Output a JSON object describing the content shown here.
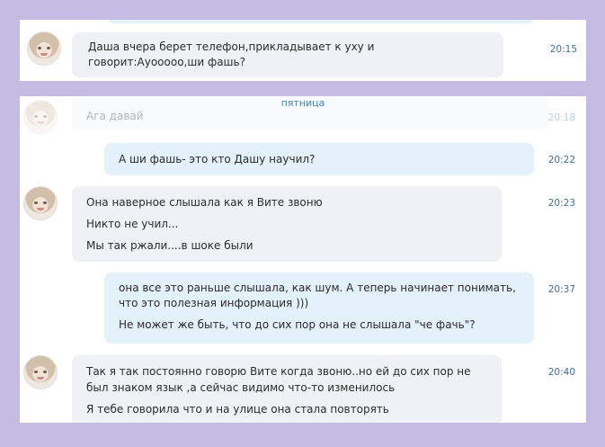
{
  "top": {
    "message": {
      "lines": [
        "Даша вчера берет телефон,прикладывает к уху и",
        "говорит:Ауооооо,ши фашь?"
      ],
      "time": "20:15"
    }
  },
  "main": {
    "day_divider": "пятница",
    "faded_message": {
      "text": "Ага давай",
      "time": "20:18"
    },
    "messages": [
      {
        "direction": "out",
        "lines": [
          "А ши фашь- это кто Дашу научил?"
        ],
        "time": "20:22"
      },
      {
        "direction": "in",
        "lines": [
          "Она наверное слышала как я Вите звоню",
          "Никто не учил...",
          "Мы так ржали....в шоке были"
        ],
        "time": "20:23"
      },
      {
        "direction": "out",
        "lines": [
          "она все это раньше слышала, как шум. А теперь начинает понимать,",
          "что это полезная информация )))",
          "Не может же быть, что до сих пор она не слышала \"че фачь\"?"
        ],
        "time": "20:37"
      },
      {
        "direction": "in",
        "lines": [
          "Так я так постоянно говорю Вите когда звоню..но ей до сих пор не",
          "был знаком язык ,а сейчас видимо что-то изменилось",
          "Я тебе говорила что и на улице она стала повторять"
        ],
        "time": "20:40"
      }
    ]
  },
  "colors": {
    "background": "#c4bce3",
    "incoming_bubble": "#eff1f6",
    "outgoing_bubble": "#e3f1fb",
    "timestamp": "#3f6f98",
    "divider": "#3f86b5"
  }
}
